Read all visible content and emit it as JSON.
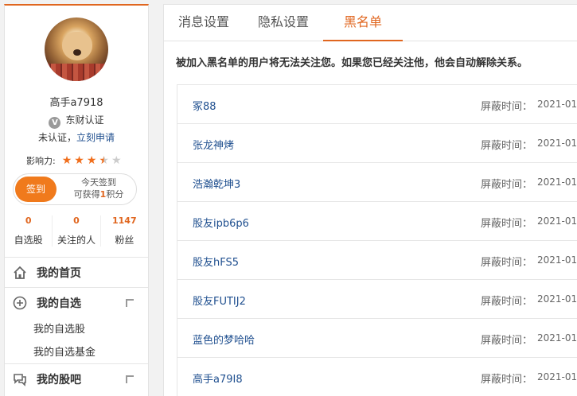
{
  "profile": {
    "username": "高手a7918",
    "certification": "东财认证",
    "cert_badge": "V",
    "uncertified_text": "未认证，",
    "apply_link": "立刻申请",
    "influence_label": "影响力:",
    "influence_rating": 3.5,
    "influence_max": 5
  },
  "checkin": {
    "button_label": "签到",
    "line1": "今天签到",
    "line2_prefix": "可获得",
    "points": "1",
    "line2_suffix": "积分"
  },
  "stats": [
    {
      "count": "0",
      "label": "自选股"
    },
    {
      "count": "0",
      "label": "关注的人"
    },
    {
      "count": "1147",
      "label": "粉丝"
    }
  ],
  "menu": {
    "home": "我的首页",
    "watchlist": "我的自选",
    "watchlist_stocks": "我的自选股",
    "watchlist_funds": "我的自选基金",
    "forum": "我的股吧"
  },
  "tabs": {
    "messages": "消息设置",
    "privacy": "隐私设置",
    "blacklist": "黑名单"
  },
  "notice": "被加入黑名单的用户将无法关注您。如果您已经关注他，他会自动解除关系。",
  "blacklist": {
    "time_label": "屏蔽时间：",
    "users": [
      {
        "name": "冢88",
        "time": "2021-01-"
      },
      {
        "name": "张龙神烤",
        "time": "2021-01-"
      },
      {
        "name": "浩瀚乾坤3",
        "time": "2021-01-"
      },
      {
        "name": "股友ipb6p6",
        "time": "2021-01-"
      },
      {
        "name": "股友hFS5",
        "time": "2021-01-"
      },
      {
        "name": "股友FUTIJ2",
        "time": "2021-01-"
      },
      {
        "name": "蓝色的梦哈哈",
        "time": "2021-01-"
      },
      {
        "name": "高手a79I8",
        "time": "2021-01-"
      }
    ]
  },
  "colors": {
    "accent": "#e0661f",
    "link": "#1f4f8f"
  }
}
